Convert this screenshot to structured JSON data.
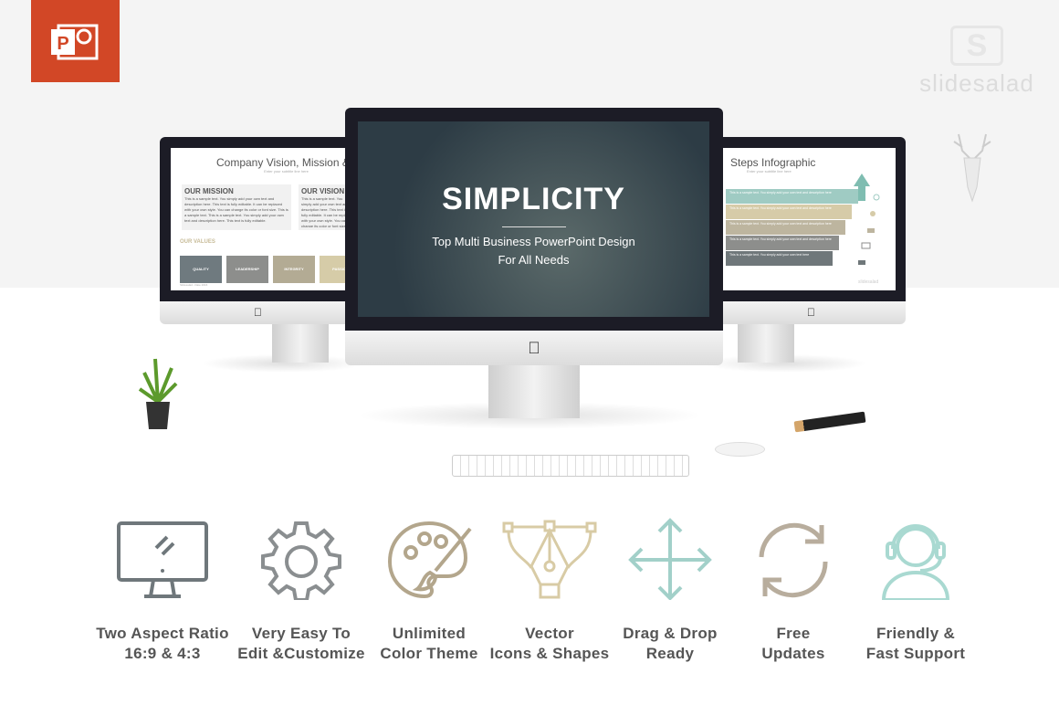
{
  "brand": {
    "logo_text": "slidesalad",
    "logo_letter": "S",
    "app_icon": "powerpoint-icon",
    "app_letter": "P"
  },
  "left_slide": {
    "title": "Company Vision, Mission & V",
    "subtitle": "Enter your subtitle line here",
    "mission_heading": "OUR MISSION",
    "mission_text": "This is a sample text. You simply add your own text and description here. This text is fully editable. It can be replaced with your own style. You can change its color or font size. This is a sample text. This is a sample text. You simply add your own text and description here. This text is fully editable.",
    "vision_heading": "OUR VISION",
    "vision_text": "This is a sample text. You simply add your own text and description here. This text is fully editable. It can be replaced with your own style. You can change its color or font size.",
    "values_heading": "OUR VALUES",
    "values": [
      "QUALITY",
      "LEADERSHIP",
      "INTEGRITY",
      "PASSION"
    ],
    "footer": "Slidesalad - Date 2016"
  },
  "center_slide": {
    "title": "SIMPLICITY",
    "line1": "Top Multi Business PowerPoint Design",
    "line2": "For All Needs"
  },
  "right_slide": {
    "title": "Steps Infographic",
    "subtitle": "Enter your subtitle line here",
    "steps": [
      "This is a sample text. You simply add your own text and description here",
      "This is a sample text. You simply add your own text and description here",
      "This is a sample text. You simply add your own text and description here",
      "This is a sample text. You simply add your own text and description here",
      "This is a sample text. You simply add your own text here"
    ],
    "step_colors": [
      "#9fcbc3",
      "#d6cba8",
      "#bdb59f",
      "#8d8e8c",
      "#6f777a"
    ],
    "watermark": "slidesalad"
  },
  "features": [
    {
      "line1": "Two Aspect Ratio",
      "line2": "16:9 & 4:3",
      "icon": "monitor-icon",
      "color": "#6f777b"
    },
    {
      "line1": "Very Easy To",
      "line2": "Edit &Customize",
      "icon": "gear-icon",
      "color": "#8a8e90"
    },
    {
      "line1": "Unlimited",
      "line2": "Color Theme",
      "icon": "palette-icon",
      "color": "#b3a68c"
    },
    {
      "line1": "Vector",
      "line2": "Icons & Shapes",
      "icon": "pen-tool-icon",
      "color": "#d8cba5"
    },
    {
      "line1": "Drag & Drop",
      "line2": "Ready",
      "icon": "move-arrows-icon",
      "color": "#a2d0c9"
    },
    {
      "line1": "Free",
      "line2": "Updates",
      "icon": "refresh-icon",
      "color": "#b8ad9d"
    },
    {
      "line1": "Friendly &",
      "line2": "Fast Support",
      "icon": "headset-icon",
      "color": "#a9d9d1"
    }
  ]
}
